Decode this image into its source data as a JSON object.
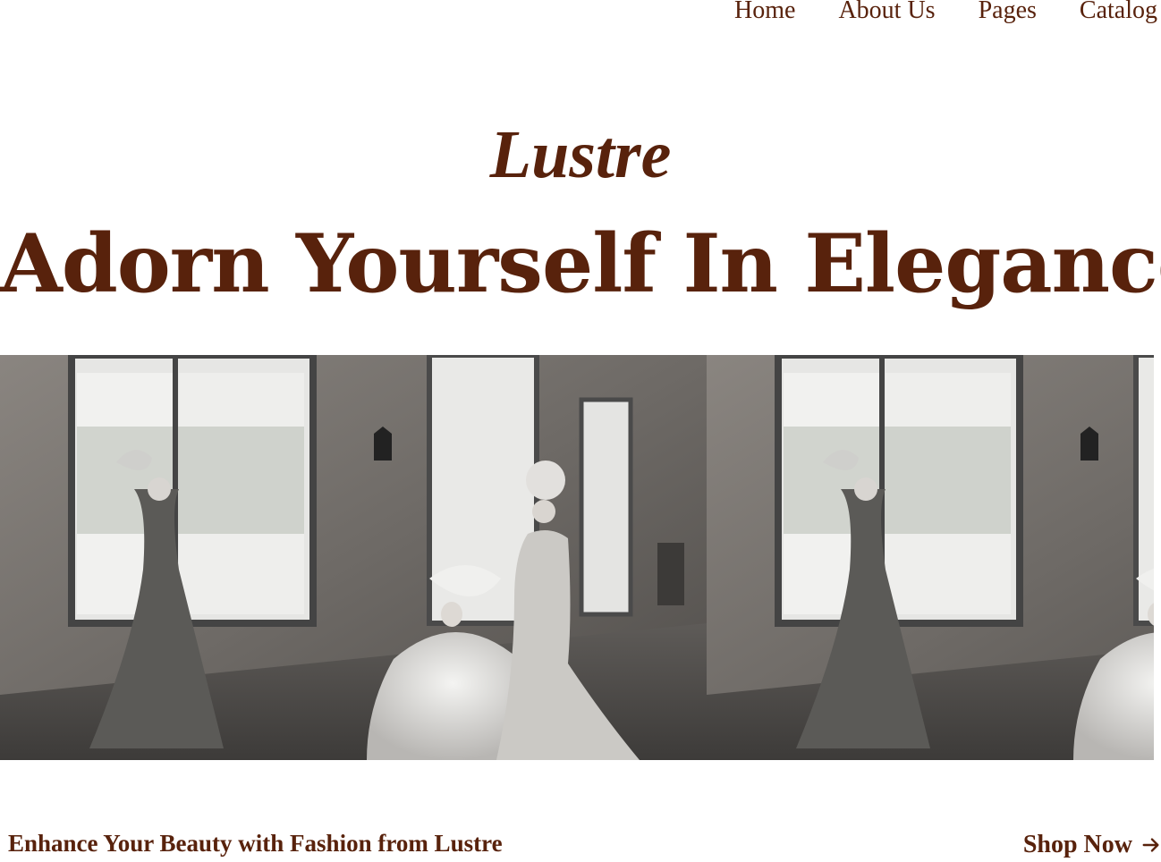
{
  "nav": {
    "items": [
      {
        "label": "Home"
      },
      {
        "label": "About Us"
      },
      {
        "label": "Pages"
      },
      {
        "label": "Catalog"
      }
    ]
  },
  "hero": {
    "brand": "Lustre",
    "title": "Adorn Yourself In Elegance"
  },
  "gallery": {
    "images": [
      {
        "subject": "photo-women-in-gowns-by-window"
      },
      {
        "subject": "photo-women-in-gowns-by-window"
      }
    ],
    "tone": "grayscale"
  },
  "footer": {
    "tagline": "Enhance Your Beauty with Fashion from Lustre",
    "cta_label": "Shop Now",
    "cta_icon": "arrow-right-icon"
  },
  "colors": {
    "brand": "#58220c",
    "background": "#ffffff"
  }
}
